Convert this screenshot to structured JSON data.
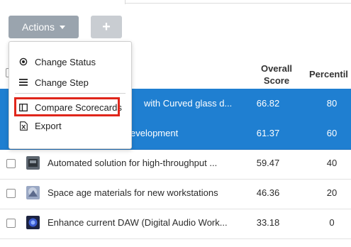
{
  "toolbar": {
    "actions_label": "Actions",
    "add_label": "+"
  },
  "table": {
    "columns": {
      "score_line1": "Overall",
      "score_line2": "Score",
      "percentile": "Percentil"
    },
    "rows": [
      {
        "title": "with Curved glass d...",
        "score": "66.82",
        "percentile": "80",
        "selected": true
      },
      {
        "title": "evelopment",
        "score": "61.37",
        "percentile": "60",
        "selected": true
      },
      {
        "title": "Automated solution for high-throughput ...",
        "score": "59.47",
        "percentile": "40",
        "selected": false
      },
      {
        "title": "Space age materials for new workstations",
        "score": "46.36",
        "percentile": "20",
        "selected": false
      },
      {
        "title": "Enhance current DAW (Digital Audio Work...",
        "score": "33.18",
        "percentile": "0",
        "selected": false
      }
    ]
  },
  "menu": {
    "items": [
      {
        "label": "Change Status",
        "icon": "radio-icon"
      },
      {
        "label": "Change Step",
        "icon": "list-icon"
      },
      {
        "label": "Compare Scorecards",
        "icon": "columns-icon"
      },
      {
        "label": "Export",
        "icon": "excel-file-icon"
      }
    ]
  },
  "colors": {
    "selected_row": "#1f7fd1",
    "actions_button": "#9aa4ae",
    "highlight": "#e0261b"
  }
}
